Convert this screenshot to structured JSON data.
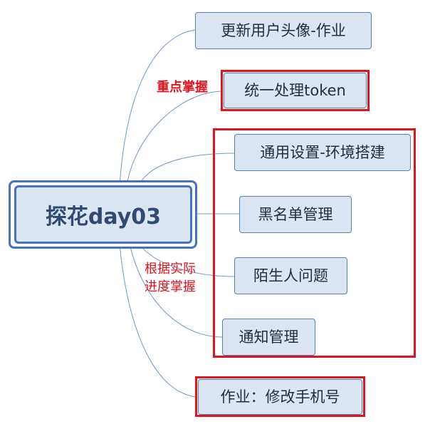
{
  "mindmap": {
    "root": "探花day03",
    "branches": [
      "更新用户头像-作业",
      "统一处理token",
      "通用设置-环境搭建",
      "黑名单管理",
      "陌生人问题",
      "通知管理",
      "作业：修改手机号"
    ],
    "notes": {
      "token_note": "重点掌握",
      "progress_note_line1": "根据实际",
      "progress_note_line2": "进度掌握"
    }
  },
  "colors": {
    "node_fill": "#dce6f2",
    "node_border": "#4f81bd",
    "root_border": "#4472c4",
    "connector": "#6f97c8",
    "highlight_red": "#e0141e"
  }
}
